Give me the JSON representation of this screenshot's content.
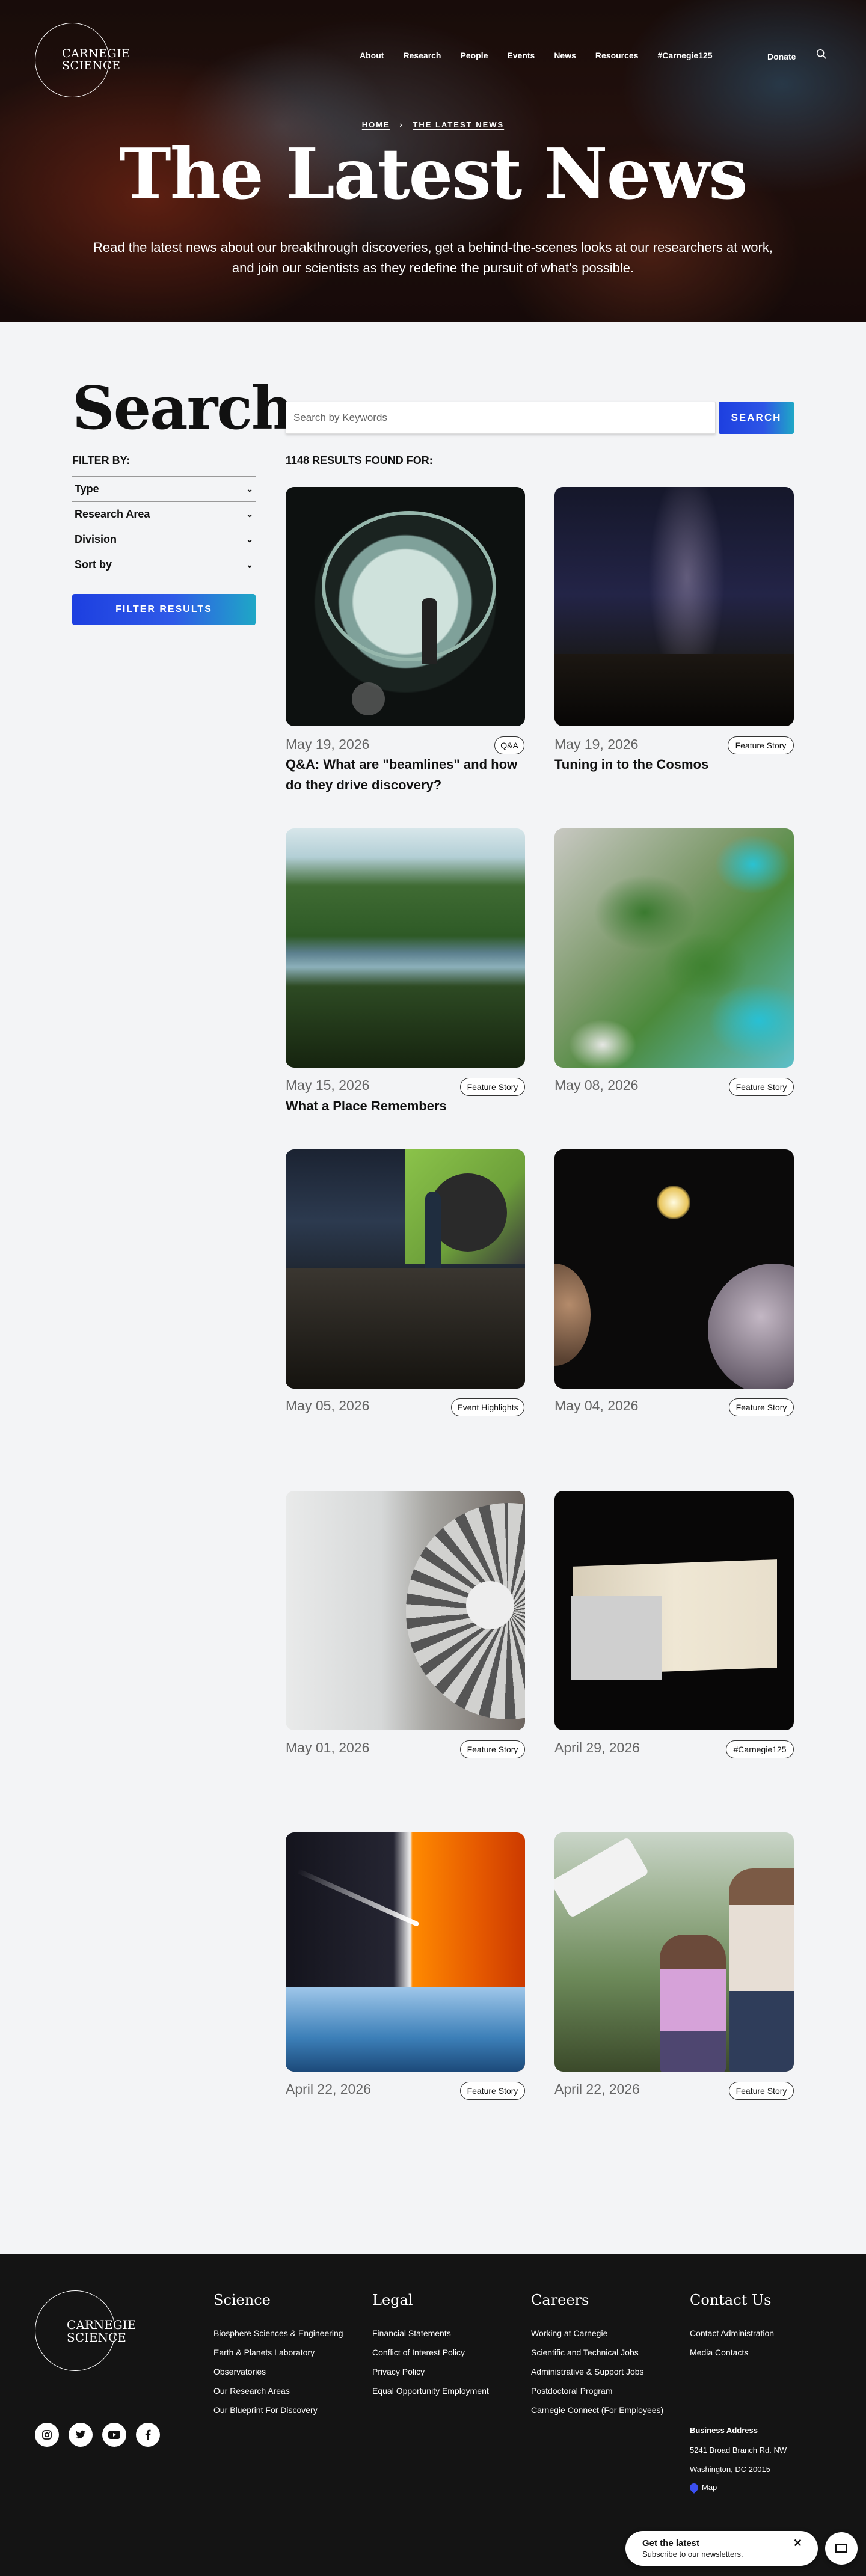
{
  "header": {
    "logo_line1": "CARNEGIE",
    "logo_line2": "SCIENCE",
    "nav": [
      "About",
      "Research",
      "People",
      "Events",
      "News",
      "Resources",
      "#Carnegie125"
    ],
    "donate": "Donate"
  },
  "hero": {
    "breadcrumb_home": "HOME",
    "breadcrumb_current": "THE LATEST NEWS",
    "title": "The Latest News",
    "subtitle": "Read the latest news about our breakthrough discoveries, get a behind-the-scenes looks at our researchers at work, and join our scientists as they redefine the pursuit of what's possible."
  },
  "sidebar": {
    "heading": "Search",
    "filter_by": "FILTER BY:",
    "filters": [
      "Type",
      "Research Area",
      "Division",
      "Sort by"
    ],
    "filter_button": "FILTER RESULTS"
  },
  "search": {
    "placeholder": "Search by Keywords",
    "button": "SEARCH",
    "results": "1148 RESULTS FOUND FOR:"
  },
  "cards": [
    {
      "date": "May 19, 2026",
      "tag": "Q&A",
      "title": "Q&A: What are \"beamlines\" and how do they drive discovery?"
    },
    {
      "date": "May 19, 2026",
      "tag": "Feature Story",
      "title": "Tuning in to the Cosmos"
    },
    {
      "date": "May 15, 2026",
      "tag": "Feature Story",
      "title": "What a Place Remembers"
    },
    {
      "date": "May 08, 2026",
      "tag": "Feature Story",
      "title": ""
    },
    {
      "date": "May 05, 2026",
      "tag": "Event Highlights",
      "title": ""
    },
    {
      "date": "May 04, 2026",
      "tag": "Feature Story",
      "title": ""
    },
    {
      "date": "May 01, 2026",
      "tag": "Feature Story",
      "title": ""
    },
    {
      "date": "April 29, 2026",
      "tag": "#Carnegie125",
      "title": ""
    },
    {
      "date": "April 22, 2026",
      "tag": "Feature Story",
      "title": ""
    },
    {
      "date": "April 22, 2026",
      "tag": "Feature Story",
      "title": ""
    }
  ],
  "footer": {
    "logo_line1": "CARNEGIE",
    "logo_line2": "SCIENCE",
    "socials": [
      "instagram-icon",
      "twitter-icon",
      "youtube-icon",
      "facebook-icon"
    ],
    "science": {
      "heading": "Science",
      "links": [
        "Biosphere Sciences & Engineering",
        "Earth & Planets Laboratory",
        "Observatories",
        "Our Research Areas",
        "Our Blueprint For Discovery"
      ]
    },
    "legal": {
      "heading": "Legal",
      "links": [
        "Financial Statements",
        "Conflict of Interest Policy",
        "Privacy Policy",
        "Equal Opportunity Employment"
      ]
    },
    "careers": {
      "heading": "Careers",
      "links": [
        "Working at Carnegie",
        "Scientific and Technical Jobs",
        "Administrative & Support Jobs",
        "Postdoctoral Program",
        "Carnegie Connect (For Employees)"
      ]
    },
    "contact": {
      "heading": "Contact Us",
      "links": [
        "Contact Administration",
        "Media Contacts"
      ]
    },
    "address_label": "Business Address",
    "address_1": "5241 Broad Branch Rd. NW",
    "address_2": "Washington, DC 20015",
    "map": "Map"
  },
  "newsletter": {
    "title": "Get the latest",
    "subtitle": "Subscribe to our newsletters."
  },
  "colors": {
    "accent_blue": "#1d3fe0",
    "accent_teal": "#1fa7c6",
    "footer_bg": "#141414"
  }
}
